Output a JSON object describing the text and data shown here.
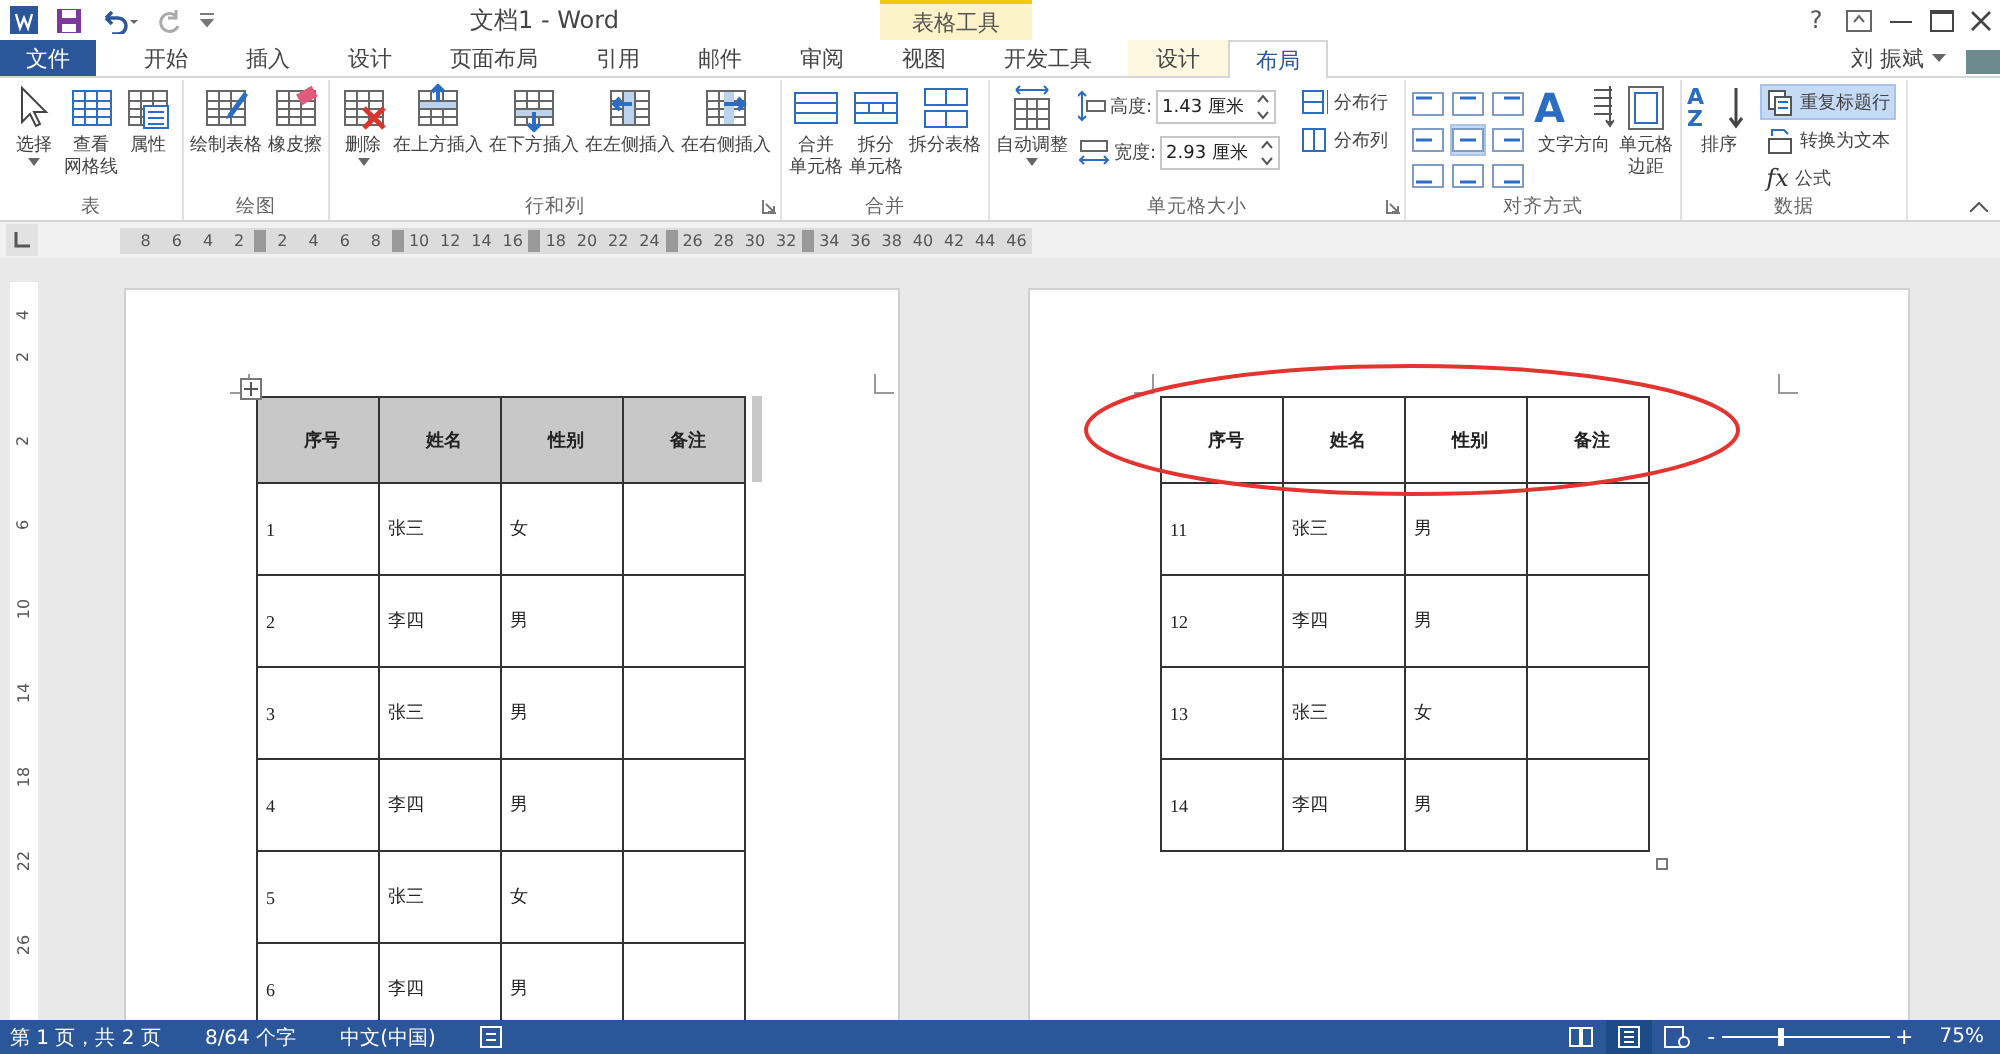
{
  "window": {
    "title": "文档1 - Word",
    "context_label": "表格工具",
    "help": "?",
    "user": "刘 振斌"
  },
  "tabs": [
    {
      "label": "文件",
      "kind": "file",
      "selected": false
    },
    {
      "label": "开始",
      "kind": "normal",
      "selected": false
    },
    {
      "label": "插入",
      "kind": "normal",
      "selected": false
    },
    {
      "label": "设计",
      "kind": "normal",
      "selected": false
    },
    {
      "label": "页面布局",
      "kind": "normal",
      "selected": false
    },
    {
      "label": "引用",
      "kind": "normal",
      "selected": false
    },
    {
      "label": "邮件",
      "kind": "normal",
      "selected": false
    },
    {
      "label": "审阅",
      "kind": "normal",
      "selected": false
    },
    {
      "label": "视图",
      "kind": "normal",
      "selected": false
    },
    {
      "label": "开发工具",
      "kind": "normal",
      "selected": false
    },
    {
      "label": "设计",
      "kind": "contextual",
      "selected": false
    },
    {
      "label": "布局",
      "kind": "contextual",
      "selected": true
    }
  ],
  "ribbon": {
    "groups": [
      {
        "label": "表",
        "launcher": false,
        "items": [
          {
            "kind": "large",
            "lines": [
              "选择"
            ],
            "dropdown": true
          },
          {
            "kind": "large",
            "lines": [
              "查看",
              "网格线"
            ],
            "dropdown": false
          },
          {
            "kind": "large",
            "lines": [
              "属性"
            ],
            "dropdown": false
          }
        ]
      },
      {
        "label": "绘图",
        "launcher": false,
        "items": [
          {
            "kind": "large",
            "lines": [
              "绘制表格"
            ],
            "dropdown": false
          },
          {
            "kind": "large",
            "lines": [
              "橡皮擦"
            ],
            "dropdown": false
          }
        ]
      },
      {
        "label": "行和列",
        "launcher": true,
        "items": [
          {
            "kind": "large",
            "lines": [
              "删除"
            ],
            "dropdown": true
          },
          {
            "kind": "large",
            "lines": [
              "在上方插入"
            ],
            "dropdown": false
          },
          {
            "kind": "large",
            "lines": [
              "在下方插入"
            ],
            "dropdown": false
          },
          {
            "kind": "large",
            "lines": [
              "在左侧插入"
            ],
            "dropdown": false
          },
          {
            "kind": "large",
            "lines": [
              "在右侧插入"
            ],
            "dropdown": false
          }
        ]
      },
      {
        "label": "合并",
        "launcher": false,
        "items": [
          {
            "kind": "large",
            "lines": [
              "合并",
              "单元格"
            ],
            "dropdown": false
          },
          {
            "kind": "large",
            "lines": [
              "拆分",
              "单元格"
            ],
            "dropdown": false
          },
          {
            "kind": "large",
            "lines": [
              "拆分表格"
            ],
            "dropdown": false
          }
        ]
      },
      {
        "label": "单元格大小",
        "launcher": true,
        "items": [
          {
            "kind": "large",
            "lines": [
              "自动调整"
            ],
            "dropdown": true
          },
          {
            "kind": "stack",
            "items": [
              {
                "kind": "field",
                "label": "高度:",
                "value": "1.43 厘米"
              },
              {
                "kind": "field",
                "label": "宽度:",
                "value": "2.93 厘米"
              }
            ]
          },
          {
            "kind": "stack",
            "items": [
              {
                "kind": "small",
                "label": "分布行",
                "selected": false
              },
              {
                "kind": "small",
                "label": "分布列",
                "selected": false
              }
            ]
          }
        ]
      },
      {
        "label": "对齐方式",
        "launcher": false,
        "items": [
          {
            "kind": "align_grid",
            "cells": [
              {
                "selected": false
              },
              {
                "selected": false
              },
              {
                "selected": false
              },
              {
                "selected": false
              },
              {
                "selected": true
              },
              {
                "selected": false
              },
              {
                "selected": false
              },
              {
                "selected": false
              },
              {
                "selected": false
              }
            ]
          },
          {
            "kind": "large",
            "lines": [
              "文字方向"
            ],
            "glyph": "A",
            "dropdown": false
          },
          {
            "kind": "large",
            "lines": [
              "单元格",
              "边距"
            ],
            "dropdown": false
          }
        ]
      },
      {
        "label": "数据",
        "launcher": false,
        "items": [
          {
            "kind": "large",
            "lines": [
              "排序"
            ],
            "glyph": "AZ",
            "dropdown": false
          },
          {
            "kind": "stack",
            "items": [
              {
                "kind": "small",
                "label": "重复标题行",
                "selected": true
              },
              {
                "kind": "small",
                "label": "转换为文本",
                "selected": false
              },
              {
                "kind": "small",
                "label": "公式",
                "glyph": "fx",
                "selected": false
              }
            ]
          }
        ]
      }
    ]
  },
  "ruler": {
    "numbers": [
      "8",
      "6",
      "4",
      "2",
      "2",
      "4",
      "6",
      "8",
      "10",
      "12",
      "14",
      "16",
      "18",
      "20",
      "22",
      "24",
      "26",
      "28",
      "30",
      "32",
      "34",
      "36",
      "38",
      "40",
      "42",
      "44",
      "46"
    ]
  },
  "vertical_ruler": {
    "numbers": [
      "4",
      "2",
      "2",
      "6",
      "10",
      "14",
      "18",
      "22",
      "26"
    ]
  },
  "pages": [
    {
      "highlight_header": false,
      "move_handle": true,
      "resize_handle": false,
      "table": {
        "header_selected": true,
        "columns": [
          "序号",
          "姓名",
          "性别",
          "备注"
        ],
        "rows": [
          [
            "1",
            "张三",
            "女"
          ],
          [
            "2",
            "李四",
            "男"
          ],
          [
            "3",
            "张三",
            "男"
          ],
          [
            "4",
            "李四",
            "男"
          ],
          [
            "5",
            "张三",
            "女"
          ],
          [
            "6",
            "李四",
            "男"
          ]
        ]
      }
    },
    {
      "highlight_header": true,
      "move_handle": false,
      "resize_handle": true,
      "table": {
        "header_selected": false,
        "columns": [
          "序号",
          "姓名",
          "性别",
          "备注"
        ],
        "rows": [
          [
            "11",
            "张三",
            "男"
          ],
          [
            "12",
            "李四",
            "男"
          ],
          [
            "13",
            "张三",
            "女"
          ],
          [
            "14",
            "李四",
            "男"
          ]
        ]
      }
    }
  ],
  "status_bar": {
    "page": "第 1 页，共 2 页",
    "words": "8/64 个字",
    "language": "中文(中国)",
    "zoom_out": "-",
    "zoom_in": "+",
    "zoom": "75%",
    "zoom_slider": {
      "level": 0.35
    }
  }
}
